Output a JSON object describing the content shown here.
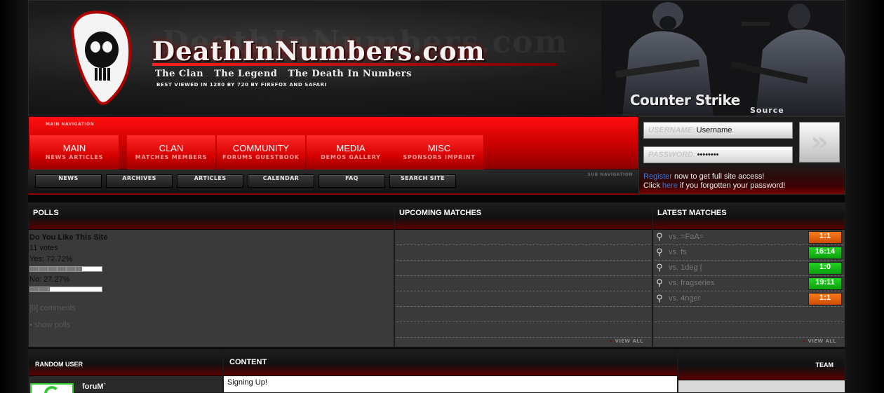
{
  "header": {
    "title": "DeathInNumbers.com",
    "watermark": "DeathInNumbers.com",
    "tagline": [
      "The Clan",
      "The Legend",
      "The Death In Numbers"
    ],
    "best_viewed": "Best viewed in 1280 by 720 by Firefox and Safari",
    "game_logo": "Counter Strike",
    "game_logo_sub": "Source"
  },
  "nav": {
    "caption": "Main Navigation",
    "items": [
      {
        "label": "MAIN",
        "sub": "News Articles"
      },
      {
        "label": "CLAN",
        "sub": "Matches Members"
      },
      {
        "label": "COMMUNITY",
        "sub": "Forums Guestbook"
      },
      {
        "label": "MEDIA",
        "sub": "Demos Gallery"
      },
      {
        "label": "MISC",
        "sub": "Sponsors Imprint"
      }
    ]
  },
  "subnav": {
    "caption": "Sub Navigation",
    "items": [
      "News",
      "Archives",
      "Articles",
      "Calendar",
      "FAQ",
      "Search Site"
    ]
  },
  "login": {
    "username_label": "USERNAME:",
    "username_value": "Username",
    "password_label": "PASSWORD:",
    "password_value": "••••••••",
    "submit_icon": "double-chevron-right-icon",
    "register_link": "Register",
    "register_text": " now to get full site access!",
    "forgot_prefix": "Click ",
    "forgot_link": "here",
    "forgot_suffix": " if you forgotten your password!"
  },
  "polls": {
    "heading": "POLLS",
    "question": "Do You Like This Site",
    "votes": "11 votes",
    "options": [
      {
        "label": "Yes: 72.72%",
        "percent": 72.72
      },
      {
        "label": "No: 27.27%",
        "percent": 27.27
      }
    ],
    "comments": "[0] comments",
    "show_polls": "• show polls"
  },
  "upcoming": {
    "heading": "UPCOMING MATCHES",
    "view_all": "View All"
  },
  "latest": {
    "heading": "LATEST MATCHES",
    "view_all": "View All",
    "matches": [
      {
        "opponent": "vs. =FaA=",
        "score": "1:1",
        "result": "draw"
      },
      {
        "opponent": "vs. fs",
        "score": "16:14",
        "result": "win"
      },
      {
        "opponent": "vs. 1deg |",
        "score": "1:0",
        "result": "win"
      },
      {
        "opponent": "vs. fragseries",
        "score": "19:11",
        "result": "win"
      },
      {
        "opponent": "vs. 4nger",
        "score": "1:1",
        "result": "draw"
      }
    ]
  },
  "random_user": {
    "heading": "RANDOM USER",
    "name": "foruM`"
  },
  "content": {
    "heading": "CONTENT",
    "first_item": "Signing Up!"
  },
  "team": {
    "heading": "TEAM"
  },
  "colors": {
    "nav_red": "#e00000",
    "win_green": "#11bb11",
    "draw_orange": "#e8620a",
    "link_blue": "#3b78d8"
  }
}
